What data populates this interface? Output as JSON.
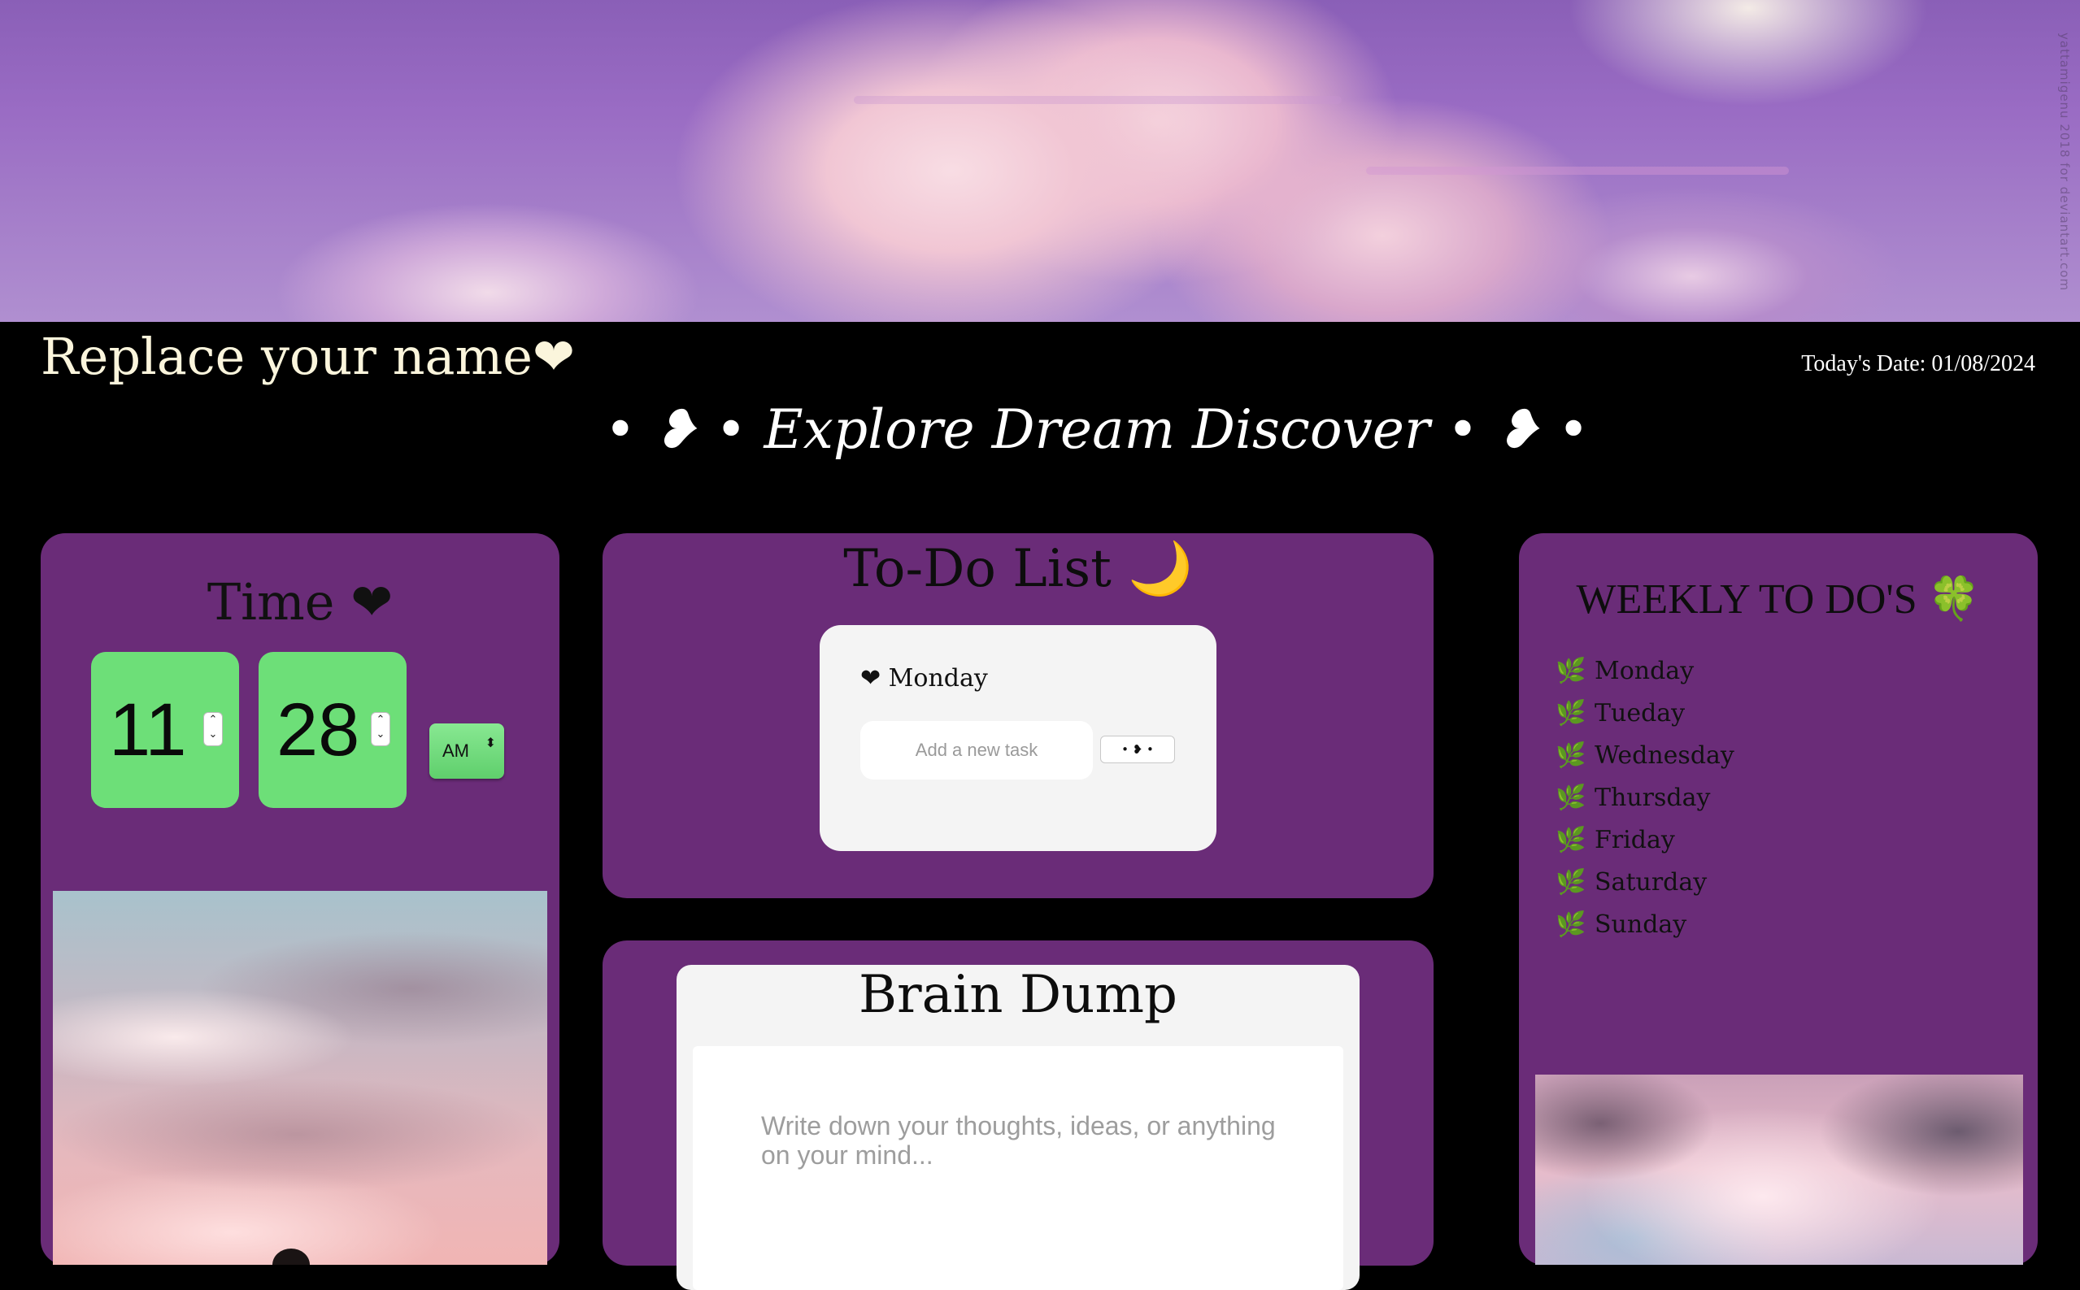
{
  "banner": {
    "watermark": "yattamigenu 2018 for deviantart.com"
  },
  "header": {
    "user_name": "Replace your name❤",
    "today_date": "Today's Date: 01/08/2024",
    "tagline": "• ❥ • Explore Dream Discover • ❥ •"
  },
  "time_widget": {
    "title": "Time ❤",
    "hours": "11",
    "minutes": "28",
    "spin_up": "⌃",
    "spin_down": "⌄",
    "period": "AM",
    "period_arrow": "⬍",
    "accent_color": "#6ddf78"
  },
  "todo": {
    "title": "To-Do List 🌙",
    "day_label": "❤ Monday",
    "input_placeholder": "Add a new task",
    "add_button_label": "• ❥ •"
  },
  "brain_dump": {
    "title": "Brain Dump",
    "placeholder": "Write down your thoughts, ideas, or anything on your mind..."
  },
  "weekly": {
    "title": "WEEKLY TO DO'S 🍀",
    "leaf_icon": "🌿",
    "days": [
      "Monday",
      "Tueday",
      "Wednesday",
      "Thursday",
      "Friday",
      "Saturday",
      "Sunday"
    ]
  },
  "theme": {
    "panel_color": "#6a2c78",
    "background": "#000000"
  }
}
